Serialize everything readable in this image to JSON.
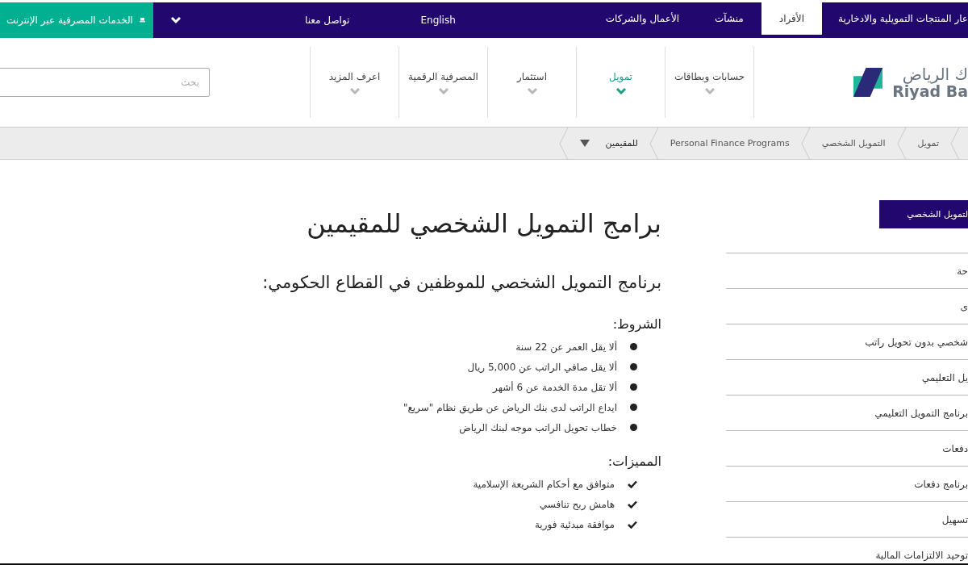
{
  "top_bar": {
    "tabs": [
      {
        "label": "عار المنتجات التمويلية والادخارية",
        "selected": false
      },
      {
        "label": "الأفراد",
        "selected": true
      },
      {
        "label": "منشآت",
        "selected": false
      },
      {
        "label": "الأعمال والشركات",
        "selected": false
      }
    ],
    "language": "English",
    "contact": "تواصل معنا",
    "online_banking": "الخدمات المصرفية عبر الإنترنت"
  },
  "header": {
    "logo": {
      "arabic": "ك الرياض",
      "latin": "Riyad Ba"
    },
    "nav": [
      {
        "label": "حسابات وبطاقات",
        "selected": false
      },
      {
        "label": "تمويل",
        "selected": true
      },
      {
        "label": "استثمار",
        "selected": false
      },
      {
        "label": "المصرفية الرقمية",
        "selected": false
      },
      {
        "label": "اعرف المزيد",
        "selected": false
      }
    ],
    "search": {
      "placeholder": "بحث"
    }
  },
  "breadcrumbs": [
    {
      "label": "تمويل",
      "kind": "link"
    },
    {
      "label": "التمويل الشخصي",
      "kind": "link"
    },
    {
      "label": "Personal Finance Programs",
      "kind": "link"
    },
    {
      "label": "للمقيمين",
      "kind": "dropdown"
    }
  ],
  "sidebar": {
    "header": "لتمويل الشخصي",
    "items": [
      "حة",
      "ى",
      "شخصي بدون تحويل راتب",
      "يل التعليمي",
      "برنامج التمويل التعليمي",
      "دفعات",
      "برنامج دفعات",
      "تسهيل",
      "توحيد الالتزامات المالية"
    ]
  },
  "content": {
    "title": "برامج التمويل الشخصي للمقيمين",
    "subtitle": "برنامج التمويل الشخصي للموظفين في القطاع الحكومي:",
    "sections": [
      {
        "heading": "الشروط:",
        "kind": "bullets",
        "items": [
          "ألا يقل العمر عن 22 سنة",
          "ألا يقل صافي الراتب عن 5,000 ريال",
          "ألا تقل مدة الخدمة عن 6 أشهر",
          "ايداع الراتب لدى بنك الرياض عن طريق نظام \"سريع\"",
          "خطاب تحويل الراتب موجه لبنك الرياض"
        ]
      },
      {
        "heading": "المميزات:",
        "kind": "checks",
        "items": [
          "متوافق مع أحكام الشريعة الإسلامية",
          "هامش ربح تنافسي",
          "موافقة مبدئية فورية"
        ]
      }
    ]
  }
}
